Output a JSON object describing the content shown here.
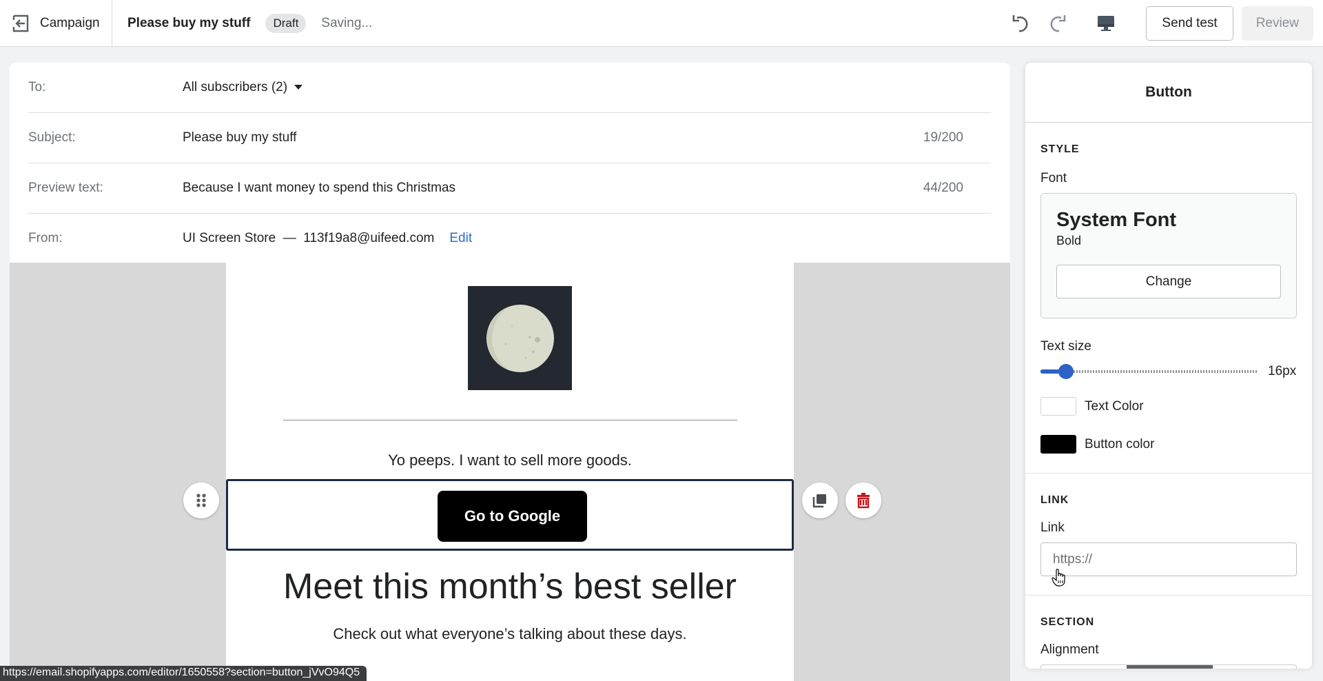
{
  "topbar": {
    "back_label": "Campaign",
    "title": "Please buy my stuff",
    "status_badge": "Draft",
    "save_status": "Saving...",
    "icons": [
      "undo-icon",
      "redo-icon",
      "desktop-preview-icon"
    ],
    "send_test_label": "Send test",
    "review_label": "Review"
  },
  "meta": {
    "to": {
      "label": "To:",
      "value": "All subscribers (2)"
    },
    "subject": {
      "label": "Subject:",
      "value": "Please buy my stuff",
      "count": "19/200"
    },
    "preview": {
      "label": "Preview text:",
      "value": "Because I want money to spend this Christmas",
      "count": "44/200"
    },
    "from": {
      "label": "From:",
      "value": "UI Screen Store  —  113f19a8@uifeed.com",
      "edit_label": "Edit"
    }
  },
  "email": {
    "image_alt": "moon",
    "paragraph": "Yo peeps. I want to sell more goods.",
    "button_label": "Go to Google",
    "headline": "Meet this month’s best seller",
    "subtext": "Check out what everyone’s talking about these days.",
    "block_actions": [
      "drag-handle-icon",
      "duplicate-icon",
      "delete-icon"
    ]
  },
  "status_url": "https://email.shopifyapps.com/editor/1650558?section=button_jVvO94Q5",
  "panel": {
    "title": "Button",
    "style": {
      "heading": "STYLE",
      "font_label": "Font",
      "font_name": "System Font",
      "font_weight": "Bold",
      "change_label": "Change",
      "text_size_label": "Text size",
      "text_size_value": "16px",
      "text_size_fraction": 0.09,
      "text_color_label": "Text Color",
      "text_color": "#ffffff",
      "button_color_label": "Button color",
      "button_color": "#000000"
    },
    "link": {
      "heading": "LINK",
      "label": "Link",
      "placeholder": "https://",
      "value": ""
    },
    "section": {
      "heading": "SECTION",
      "alignment_label": "Alignment",
      "alignment_selected": "center"
    }
  },
  "colors": {
    "accent": "#2c62c6",
    "link": "#2c6ecb",
    "delete": "#c4161c",
    "selection_border": "#1c2b45"
  }
}
